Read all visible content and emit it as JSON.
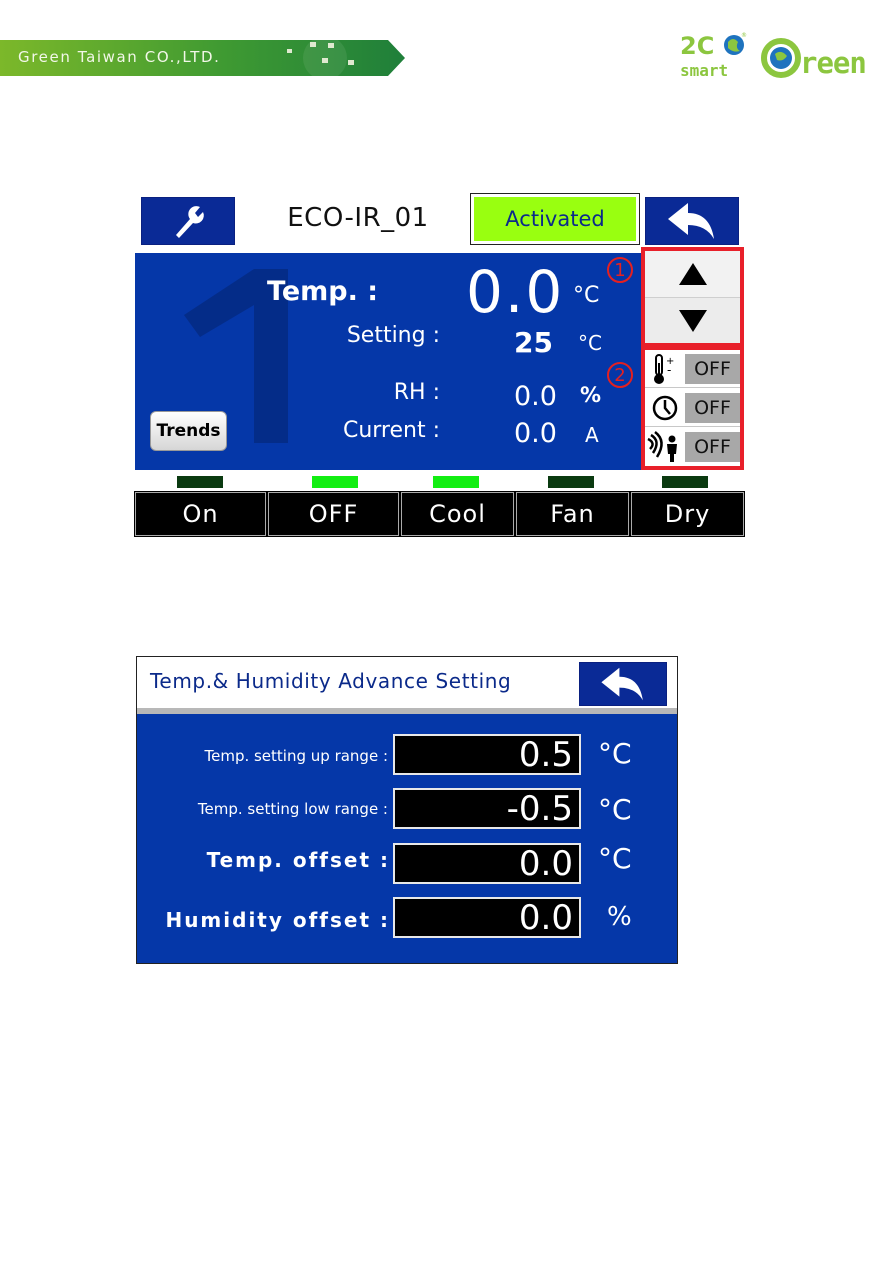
{
  "header": {
    "company": "Green Taiwan CO.,LTD.",
    "logos": [
      "eco smart",
      "Green"
    ],
    "colors": {
      "banner": "#4f9a2a",
      "logo_green": "#8cc63f",
      "logo_blue": "#1e73be"
    }
  },
  "main_screen": {
    "device_name": "ECO-IR_01",
    "status_label": "Activated",
    "background_number": "1",
    "trends_button": "Trends",
    "readings": {
      "temp": {
        "label": "Temp. :",
        "value": "0.0",
        "unit": "°C"
      },
      "setting": {
        "label": "Setting :",
        "value": "25",
        "unit": "°C"
      },
      "rh": {
        "label": "RH :",
        "value": "0.0",
        "unit": "%"
      },
      "current": {
        "label": "Current :",
        "value": "0.0",
        "unit": "A"
      }
    },
    "callouts": [
      "1",
      "2"
    ],
    "toggles": [
      {
        "icon": "thermometer-plus-minus-icon",
        "value": "OFF"
      },
      {
        "icon": "clock-icon",
        "value": "OFF"
      },
      {
        "icon": "occupancy-sensor-icon",
        "value": "OFF"
      }
    ],
    "modes": [
      {
        "label": "On",
        "led": "off"
      },
      {
        "label": "OFF",
        "led": "on"
      },
      {
        "label": "Cool",
        "led": "on"
      },
      {
        "label": "Fan",
        "led": "off"
      },
      {
        "label": "Dry",
        "led": "off"
      }
    ],
    "colors": {
      "panel": "#0537a8",
      "nav": "#0a2a96",
      "status": "#99ff10",
      "led_on": "#12ee12",
      "led_off": "#0a3a10",
      "highlight": "#e8202a"
    }
  },
  "advance_screen": {
    "title": "Temp.& Humidity Advance Setting",
    "fields": [
      {
        "label": "Temp. setting up range :",
        "value": "0.5",
        "unit": "°C"
      },
      {
        "label": "Temp. setting low range :",
        "value": "-0.5",
        "unit": "°C"
      },
      {
        "label": "Temp. offset :",
        "value": "0.0",
        "unit": "°C"
      },
      {
        "label": "Humidity offset :",
        "value": "0.0",
        "unit": "%"
      }
    ]
  }
}
